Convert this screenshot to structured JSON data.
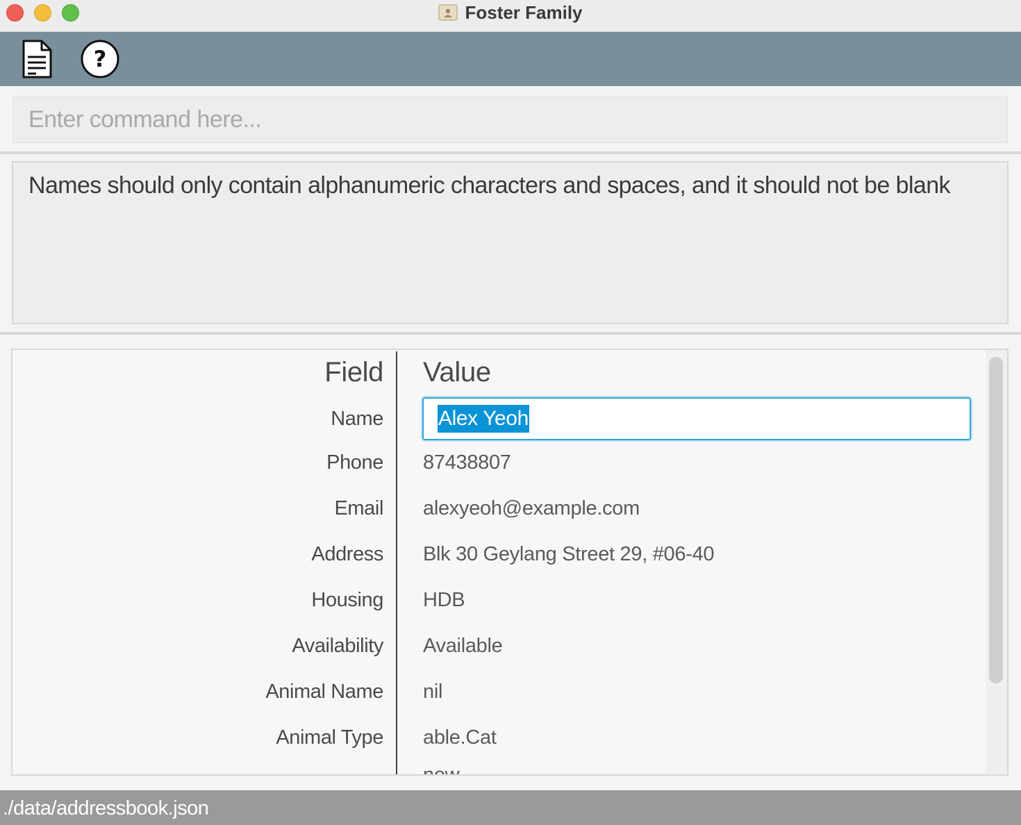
{
  "window": {
    "title": "Foster Family",
    "icon": "contact-card-icon"
  },
  "toolbar": {
    "file_icon": "document-icon",
    "help_icon": "question-icon"
  },
  "command": {
    "placeholder": "Enter command here..."
  },
  "result": {
    "message": "Names should only contain alphanumeric characters and spaces, and it should not be blank"
  },
  "details": {
    "header_field": "Field",
    "header_value": "Value",
    "rows": [
      {
        "field": "Name",
        "value": "Alex Yeoh"
      },
      {
        "field": "Phone",
        "value": "87438807"
      },
      {
        "field": "Email",
        "value": "alexyeoh@example.com"
      },
      {
        "field": "Address",
        "value": "Blk 30 Geylang Street 29, #06-40"
      },
      {
        "field": "Housing",
        "value": "HDB"
      },
      {
        "field": "Availability",
        "value": "Available"
      },
      {
        "field": "Animal Name",
        "value": "nil"
      },
      {
        "field": "Animal Type",
        "value": "able.Cat"
      },
      {
        "field": "",
        "value": "now"
      }
    ]
  },
  "status": {
    "path": "./data/addressbook.json"
  },
  "colors": {
    "toolbar_bg": "#798f9b",
    "selection": "#0a94d6",
    "focus_border": "#2fa4d8",
    "status_bg": "#9a9a9a"
  }
}
